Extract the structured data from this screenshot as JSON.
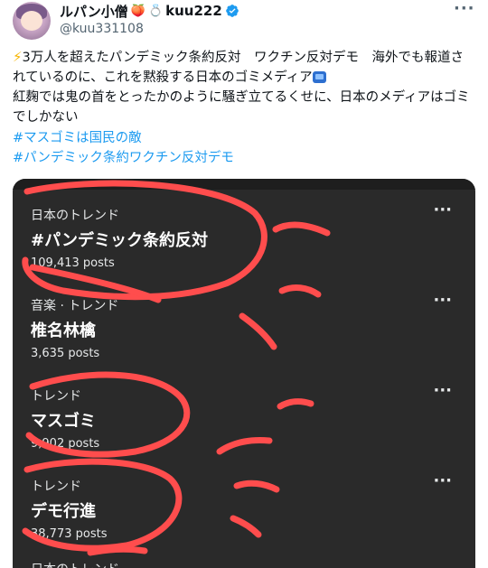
{
  "author": {
    "display_name": "ルパン小僧",
    "display_name_suffix": "kuu222",
    "handle": "@kuu331108",
    "peach_emoji": "🍑",
    "ring_emoji": "💍",
    "verified_color": "#1d9bf0"
  },
  "post": {
    "bolt_emoji": "⚡",
    "text_line1": "3万人を超えたパンデミック条約反対　ワクチン反対デモ　海外でも報道されているのに、これを黙殺する日本のゴミメディア",
    "text_line2": "紅麹では鬼の首をとったかのように騒ぎ立てるくせに、日本のメディアはゴミでしかない",
    "hashtags": [
      "#マスゴミは国民の敵",
      "#パンデミック条約ワクチン反対デモ"
    ]
  },
  "trends": [
    {
      "context": "日本のトレンド",
      "name": "#パンデミック条約反対",
      "count": "109,413 posts"
    },
    {
      "context": "音楽 · トレンド",
      "name": "椎名林檎",
      "count": "3,635 posts"
    },
    {
      "context": "トレンド",
      "name": "マスゴミ",
      "count": "9,902 posts"
    },
    {
      "context": "トレンド",
      "name": "デモ行進",
      "count": "38,773 posts"
    },
    {
      "context": "日本のトレンド",
      "name": "",
      "count": ""
    }
  ],
  "colors": {
    "hashtag": "#1d9bf0",
    "media_bg": "#2a2a2a",
    "annotation_red": "#ff4d4d"
  }
}
